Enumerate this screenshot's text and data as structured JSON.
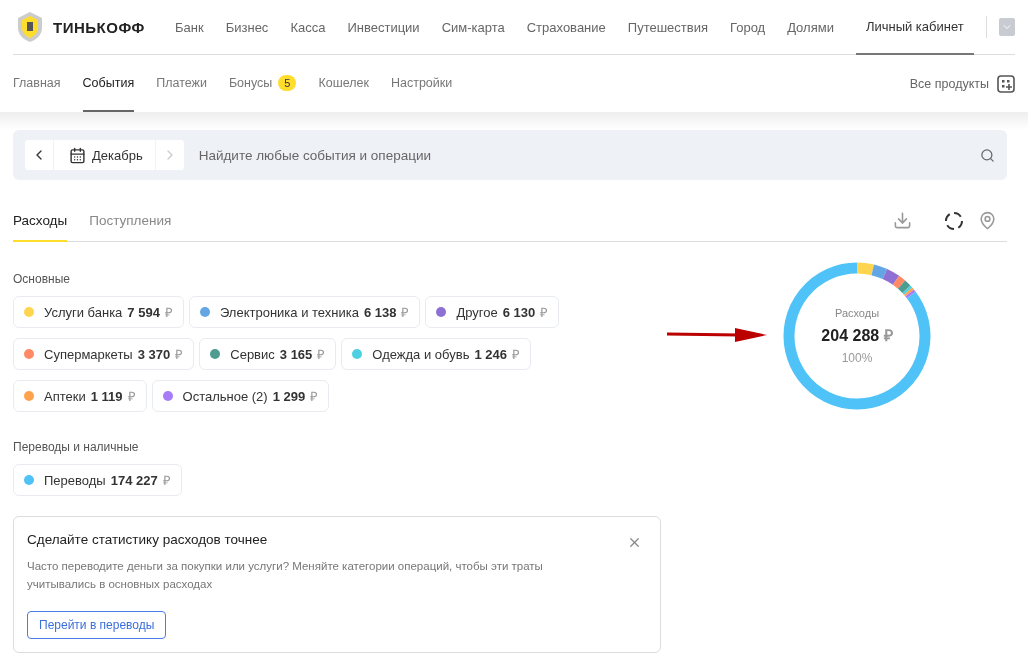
{
  "header": {
    "logo": "ТИНЬКОФФ",
    "nav": [
      {
        "label": "Банк",
        "selected": false
      },
      {
        "label": "Бизнес",
        "selected": false
      },
      {
        "label": "Касса",
        "selected": false
      },
      {
        "label": "Инвестиции",
        "selected": false
      },
      {
        "label": "Сим-карта",
        "selected": false
      },
      {
        "label": "Страхование",
        "selected": false
      },
      {
        "label": "Путешествия",
        "selected": false
      },
      {
        "label": "Город",
        "selected": false
      },
      {
        "label": "Долями",
        "selected": false
      }
    ],
    "account": {
      "label": "Личный кабинет",
      "selected": true
    }
  },
  "subnav": {
    "items": [
      {
        "label": "Главная",
        "selected": false
      },
      {
        "label": "События",
        "selected": true
      },
      {
        "label": "Платежи",
        "selected": false
      },
      {
        "label": "Бонусы",
        "selected": false,
        "badge": "5"
      },
      {
        "label": "Кошелек",
        "selected": false
      },
      {
        "label": "Настройки",
        "selected": false
      }
    ],
    "all_products": "Все продукты"
  },
  "search": {
    "month": "Декабрь",
    "placeholder": "Найдите любые события и операции"
  },
  "tabs": [
    {
      "label": "Расходы",
      "selected": true
    },
    {
      "label": "Поступления",
      "selected": false
    }
  ],
  "groups": [
    {
      "title": "Основные",
      "chips": [
        {
          "name": "Услуги банка",
          "amount": "7 594",
          "currency": "₽",
          "color": "#ffd54f"
        },
        {
          "name": "Электроника и техника",
          "amount": "6 138",
          "currency": "₽",
          "color": "#64a6e3"
        },
        {
          "name": "Другое",
          "amount": "6 130",
          "currency": "₽",
          "color": "#8e6fd4"
        },
        {
          "name": "Супермаркеты",
          "amount": "3 370",
          "currency": "₽",
          "color": "#ff8a65"
        },
        {
          "name": "Сервис",
          "amount": "3 165",
          "currency": "₽",
          "color": "#4e9b8f"
        },
        {
          "name": "Одежда и обувь",
          "amount": "1 246",
          "currency": "₽",
          "color": "#4dd0e1"
        },
        {
          "name": "Аптеки",
          "amount": "1 119",
          "currency": "₽",
          "color": "#ffa24c"
        },
        {
          "name": "Остальное (2)",
          "amount": "1 299",
          "currency": "₽",
          "color": "#a67cf7"
        }
      ]
    },
    {
      "title": "Переводы и наличные",
      "chips": [
        {
          "name": "Переводы",
          "amount": "174 227",
          "currency": "₽",
          "color": "#4fc3f7"
        }
      ]
    }
  ],
  "summary": {
    "label": "Расходы",
    "total": "204 288",
    "currency": "₽",
    "percent": "100%"
  },
  "tip": {
    "title": "Сделайте статистику расходов точнее",
    "text": "Часто переводите деньги за покупки или услуги? Меняйте категории операций, чтобы эти траты учитывались в основных расходах",
    "button": "Перейти в переводы"
  }
}
